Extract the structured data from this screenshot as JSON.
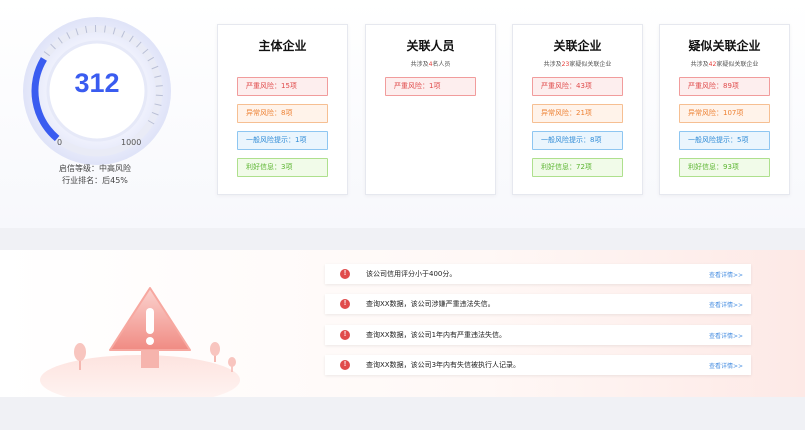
{
  "gauge": {
    "score": "312",
    "min_label": "0",
    "max_label": "1000",
    "level_text": "启信等级：中高风险",
    "rank_text": "行业排名：后45%",
    "fill_fraction": 0.312,
    "accent_color": "#3a5cf0"
  },
  "cards": [
    {
      "title": "主体企业",
      "subtitle": null,
      "tags": [
        {
          "label": "严重风险：15项",
          "tone": "red"
        },
        {
          "label": "异常风险：8项",
          "tone": "orange"
        },
        {
          "label": "一般风险提示：1项",
          "tone": "blue"
        },
        {
          "label": "利好信息：3项",
          "tone": "green"
        }
      ]
    },
    {
      "title": "关联人员",
      "subtitle": {
        "prefix": "共涉及",
        "num": "4",
        "suffix": "名人员"
      },
      "tags": [
        {
          "label": "严重风险：1项",
          "tone": "red"
        }
      ]
    },
    {
      "title": "关联企业",
      "subtitle": {
        "prefix": "共涉及",
        "num": "23",
        "suffix": "家疑似关联企业"
      },
      "tags": [
        {
          "label": "严重风险：43项",
          "tone": "red"
        },
        {
          "label": "异常风险：21项",
          "tone": "orange"
        },
        {
          "label": "一般风险提示：8项",
          "tone": "blue"
        },
        {
          "label": "利好信息：72项",
          "tone": "green"
        }
      ]
    },
    {
      "title": "疑似关联企业",
      "subtitle": {
        "prefix": "共涉及",
        "num": "42",
        "suffix": "家疑似关联企业"
      },
      "tags": [
        {
          "label": "严重风险：89项",
          "tone": "red"
        },
        {
          "label": "异常风险：107项",
          "tone": "orange"
        },
        {
          "label": "一般风险提示：5项",
          "tone": "blue"
        },
        {
          "label": "利好信息：93项",
          "tone": "green"
        }
      ]
    }
  ],
  "alerts": [
    {
      "icon": "!",
      "text": "该公司信用评分小于400分。",
      "link": "查看详情>>"
    },
    {
      "icon": "!",
      "text": "查询XX数据，该公司涉嫌严重违法失信。",
      "link": "查看详情>>"
    },
    {
      "icon": "!",
      "text": "查询XX数据，该公司1年内有严重违法失信。",
      "link": "查看详情>>"
    },
    {
      "icon": "!",
      "text": "查询XX数据，该公司3年内有失信被执行人记录。",
      "link": "查看详情>>"
    }
  ]
}
